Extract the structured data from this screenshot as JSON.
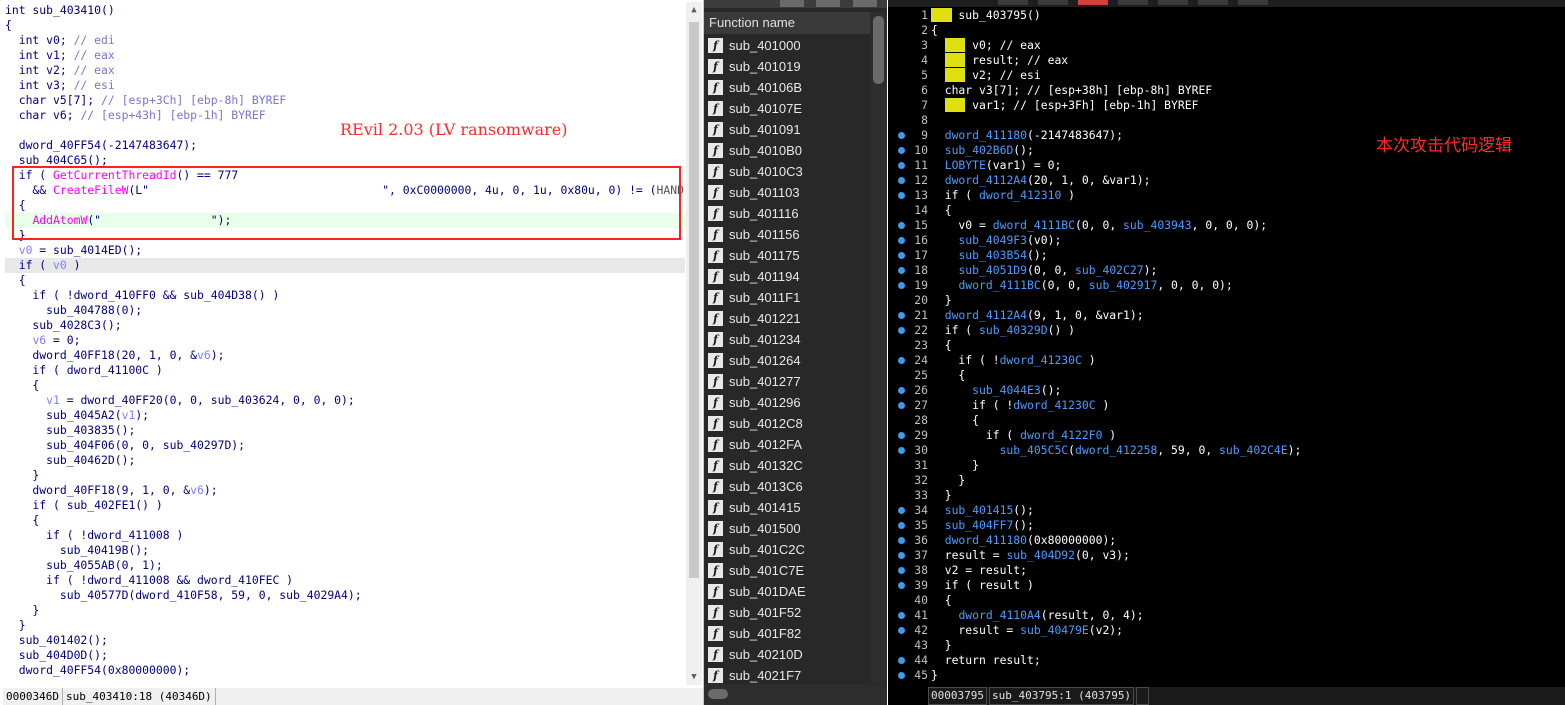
{
  "left": {
    "annotation": "REvil 2.03 (LV ransomware)",
    "status_address": "0000346D",
    "status_location": "sub_403410:18 (40346D)",
    "lines": [
      [
        [
          "int sub_403410()",
          "kw"
        ]
      ],
      [
        [
          "{",
          "kw"
        ]
      ],
      [
        [
          "  int v0; ",
          "kw"
        ],
        [
          "// edi",
          "cm"
        ]
      ],
      [
        [
          "  int v1; ",
          "kw"
        ],
        [
          "// eax",
          "cm"
        ]
      ],
      [
        [
          "  int v2; ",
          "kw"
        ],
        [
          "// eax",
          "cm"
        ]
      ],
      [
        [
          "  int v3; ",
          "kw"
        ],
        [
          "// esi",
          "cm"
        ]
      ],
      [
        [
          "  char v5[7]; ",
          "kw"
        ],
        [
          "// [esp+3Ch] [ebp-8h] BYREF",
          "cm"
        ]
      ],
      [
        [
          "  char v6; ",
          "kw"
        ],
        [
          "// [esp+43h] [ebp-1h] BYREF",
          "cm"
        ]
      ],
      [
        [
          "",
          ""
        ]
      ],
      [
        [
          "  dword_40FF54(-2147483647);",
          "kw"
        ]
      ],
      [
        [
          "  sub_404C65();",
          "kw"
        ]
      ],
      [
        [
          "  if ( ",
          "kw"
        ],
        [
          "GetCurrentThreadId",
          "fn"
        ],
        [
          "() == 777",
          "kw"
        ]
      ],
      [
        [
          "    && ",
          "kw"
        ],
        [
          "CreateFileW",
          "fn"
        ],
        [
          "(L\"                                  \", 0xC0000000, 4u, 0, 1u, 0x80u, 0) != (",
          "kw"
        ],
        [
          "HANDLE",
          "gr"
        ],
        [
          ")-",
          "kw"
        ]
      ],
      [
        [
          "  {",
          "kw"
        ]
      ],
      [
        [
          "    ",
          "kw"
        ],
        [
          "AddAtomW",
          "fn"
        ],
        [
          "(\"                \");",
          "kw"
        ]
      ],
      [
        [
          "  }",
          "kw"
        ]
      ],
      [
        [
          "  v0",
          "lvar"
        ],
        [
          " = sub_4014ED();",
          "kw"
        ]
      ],
      [
        [
          "  if ( ",
          "kw"
        ],
        [
          "v0",
          "lvar"
        ],
        [
          " )",
          "kw"
        ]
      ],
      [
        [
          "  {",
          "kw"
        ]
      ],
      [
        [
          "    if ( !dword_410FF0 && sub_404D38() )",
          "kw"
        ]
      ],
      [
        [
          "      sub_404788(0);",
          "kw"
        ]
      ],
      [
        [
          "    sub_4028C3();",
          "kw"
        ]
      ],
      [
        [
          "    ",
          "kw"
        ],
        [
          "v6",
          "lvar"
        ],
        [
          " = 0;",
          "kw"
        ]
      ],
      [
        [
          "    dword_40FF18(20, 1, 0, &",
          "kw"
        ],
        [
          "v6",
          "lvar"
        ],
        [
          ");",
          "kw"
        ]
      ],
      [
        [
          "    if ( dword_41100C )",
          "kw"
        ]
      ],
      [
        [
          "    {",
          "kw"
        ]
      ],
      [
        [
          "      ",
          "kw"
        ],
        [
          "v1",
          "lvar"
        ],
        [
          " = dword_40FF20(0, 0, sub_403624, 0, 0, 0);",
          "kw"
        ]
      ],
      [
        [
          "      sub_4045A2(",
          "kw"
        ],
        [
          "v1",
          "lvar"
        ],
        [
          ");",
          "kw"
        ]
      ],
      [
        [
          "      sub_403835();",
          "kw"
        ]
      ],
      [
        [
          "      sub_404F06(0, 0, sub_40297D);",
          "kw"
        ]
      ],
      [
        [
          "      sub_40462D();",
          "kw"
        ]
      ],
      [
        [
          "    }",
          "kw"
        ]
      ],
      [
        [
          "    dword_40FF18(9, 1, 0, &",
          "kw"
        ],
        [
          "v6",
          "lvar"
        ],
        [
          ");",
          "kw"
        ]
      ],
      [
        [
          "    if ( sub_402FE1() )",
          "kw"
        ]
      ],
      [
        [
          "    {",
          "kw"
        ]
      ],
      [
        [
          "      if ( !dword_411008 )",
          "kw"
        ]
      ],
      [
        [
          "        sub_40419B();",
          "kw"
        ]
      ],
      [
        [
          "      sub_4055AB(0, 1);",
          "kw"
        ]
      ],
      [
        [
          "      if ( !dword_411008 && dword_410FEC )",
          "kw"
        ]
      ],
      [
        [
          "        sub_40577D(dword_410F58, 59, 0, sub_4029A4);",
          "kw"
        ]
      ],
      [
        [
          "    }",
          "kw"
        ]
      ],
      [
        [
          "  }",
          "kw"
        ]
      ],
      [
        [
          "  sub_401402();",
          "kw"
        ]
      ],
      [
        [
          "  sub_404D0D();",
          "kw"
        ]
      ],
      [
        [
          "  dword_40FF54(0x80000000);",
          "kw"
        ]
      ]
    ]
  },
  "functions": {
    "header": "Function name",
    "items": [
      "sub_401000",
      "sub_401019",
      "sub_40106B",
      "sub_40107E",
      "sub_401091",
      "sub_4010B0",
      "sub_4010C3",
      "sub_401103",
      "sub_401116",
      "sub_401156",
      "sub_401175",
      "sub_401194",
      "sub_4011F1",
      "sub_401221",
      "sub_401234",
      "sub_401264",
      "sub_401277",
      "sub_401296",
      "sub_4012C8",
      "sub_4012FA",
      "sub_40132C",
      "sub_4013C6",
      "sub_401415",
      "sub_401500",
      "sub_401C2C",
      "sub_401C7E",
      "sub_401DAE",
      "sub_401F52",
      "sub_401F82",
      "sub_40210D",
      "sub_4021F7"
    ]
  },
  "right": {
    "annotation": "本次攻击代码逻辑",
    "status_address": "00003795",
    "status_location": "sub_403795:1 (403795)",
    "lines": [
      {
        "n": "1",
        "bp": false,
        "s": [
          [
            "int",
            "rkw"
          ],
          [
            " sub_403795()",
            "rk"
          ]
        ]
      },
      {
        "n": "2",
        "bp": false,
        "s": [
          [
            "{",
            "rk"
          ]
        ]
      },
      {
        "n": "3",
        "bp": false,
        "s": [
          [
            "  ",
            "rk"
          ],
          [
            "int",
            "rkw"
          ],
          [
            " v0; // eax",
            "rk"
          ]
        ]
      },
      {
        "n": "4",
        "bp": false,
        "s": [
          [
            "  ",
            "rk"
          ],
          [
            "int",
            "rkw"
          ],
          [
            " result; // eax",
            "rk"
          ]
        ]
      },
      {
        "n": "5",
        "bp": false,
        "s": [
          [
            "  ",
            "rk"
          ],
          [
            "int",
            "rkw"
          ],
          [
            " v2; // esi",
            "rk"
          ]
        ]
      },
      {
        "n": "6",
        "bp": false,
        "s": [
          [
            "  char v3[7]; // [esp+38h] [ebp-8h] BYREF",
            "rk"
          ]
        ]
      },
      {
        "n": "7",
        "bp": false,
        "s": [
          [
            "  ",
            "rk"
          ],
          [
            "int",
            "rkw"
          ],
          [
            " var1; // [esp+3Fh] [ebp-1h] BYREF",
            "rk"
          ]
        ]
      },
      {
        "n": "8",
        "bp": false,
        "s": [
          [
            "",
            "rk"
          ]
        ]
      },
      {
        "n": "9",
        "bp": true,
        "s": [
          [
            "  ",
            "rk"
          ],
          [
            "dword_411180",
            "rgv"
          ],
          [
            "(-2147483647);",
            "rk"
          ]
        ]
      },
      {
        "n": "10",
        "bp": true,
        "s": [
          [
            "  ",
            "rk"
          ],
          [
            "sub_402B6D",
            "rfn"
          ],
          [
            "();",
            "rk"
          ]
        ]
      },
      {
        "n": "11",
        "bp": true,
        "s": [
          [
            "  ",
            "rk"
          ],
          [
            "LOBYTE",
            "rgv"
          ],
          [
            "(var1) = 0;",
            "rk"
          ]
        ]
      },
      {
        "n": "12",
        "bp": true,
        "s": [
          [
            "  ",
            "rk"
          ],
          [
            "dword_4112A4",
            "rgv"
          ],
          [
            "(20, 1, 0, &var1);",
            "rk"
          ]
        ]
      },
      {
        "n": "13",
        "bp": true,
        "s": [
          [
            "  if ( ",
            "rk"
          ],
          [
            "dword_412310",
            "rgv"
          ],
          [
            " )",
            "rk"
          ]
        ]
      },
      {
        "n": "14",
        "bp": false,
        "s": [
          [
            "  {",
            "rk"
          ]
        ]
      },
      {
        "n": "15",
        "bp": true,
        "s": [
          [
            "    v0 = ",
            "rk"
          ],
          [
            "dword_4111BC",
            "rgv"
          ],
          [
            "(0, 0, ",
            "rk"
          ],
          [
            "sub_403943",
            "rfn"
          ],
          [
            ", 0, 0, 0);",
            "rk"
          ]
        ]
      },
      {
        "n": "16",
        "bp": true,
        "s": [
          [
            "    ",
            "rk"
          ],
          [
            "sub_4049F3",
            "rfn"
          ],
          [
            "(v0);",
            "rk"
          ]
        ]
      },
      {
        "n": "17",
        "bp": true,
        "s": [
          [
            "    ",
            "rk"
          ],
          [
            "sub_403B54",
            "rfn"
          ],
          [
            "();",
            "rk"
          ]
        ]
      },
      {
        "n": "18",
        "bp": true,
        "s": [
          [
            "    ",
            "rk"
          ],
          [
            "sub_4051D9",
            "rfn"
          ],
          [
            "(0, 0, ",
            "rk"
          ],
          [
            "sub_402C27",
            "rfn"
          ],
          [
            ");",
            "rk"
          ]
        ]
      },
      {
        "n": "19",
        "bp": true,
        "s": [
          [
            "    ",
            "rk"
          ],
          [
            "dword_4111BC",
            "rgv"
          ],
          [
            "(0, 0, ",
            "rk"
          ],
          [
            "sub_402917",
            "rfn"
          ],
          [
            ", 0, 0, 0);",
            "rk"
          ]
        ]
      },
      {
        "n": "20",
        "bp": false,
        "s": [
          [
            "  }",
            "rk"
          ]
        ]
      },
      {
        "n": "21",
        "bp": true,
        "s": [
          [
            "  ",
            "rk"
          ],
          [
            "dword_4112A4",
            "rgv"
          ],
          [
            "(9, 1, 0, &var1);",
            "rk"
          ]
        ]
      },
      {
        "n": "22",
        "bp": true,
        "s": [
          [
            "  if ( ",
            "rk"
          ],
          [
            "sub_40329D",
            "rfn"
          ],
          [
            "() )",
            "rk"
          ]
        ]
      },
      {
        "n": "23",
        "bp": false,
        "s": [
          [
            "  {",
            "rk"
          ]
        ]
      },
      {
        "n": "24",
        "bp": true,
        "s": [
          [
            "    if ( !",
            "rk"
          ],
          [
            "dword_41230C",
            "rgv"
          ],
          [
            " )",
            "rk"
          ]
        ]
      },
      {
        "n": "25",
        "bp": false,
        "s": [
          [
            "    {",
            "rk"
          ]
        ]
      },
      {
        "n": "26",
        "bp": true,
        "s": [
          [
            "      ",
            "rk"
          ],
          [
            "sub_4044E3",
            "rfn"
          ],
          [
            "();",
            "rk"
          ]
        ]
      },
      {
        "n": "27",
        "bp": true,
        "s": [
          [
            "      if ( !",
            "rk"
          ],
          [
            "dword_41230C",
            "rgv"
          ],
          [
            " )",
            "rk"
          ]
        ]
      },
      {
        "n": "28",
        "bp": false,
        "s": [
          [
            "      {",
            "rk"
          ]
        ]
      },
      {
        "n": "29",
        "bp": true,
        "s": [
          [
            "        if ( ",
            "rk"
          ],
          [
            "dword_4122F0",
            "rgv"
          ],
          [
            " )",
            "rk"
          ]
        ]
      },
      {
        "n": "30",
        "bp": true,
        "s": [
          [
            "          ",
            "rk"
          ],
          [
            "sub_405C5C",
            "rfn"
          ],
          [
            "(",
            "rk"
          ],
          [
            "dword_412258",
            "rgv"
          ],
          [
            ", 59, 0, ",
            "rk"
          ],
          [
            "sub_402C4E",
            "rfn"
          ],
          [
            ");",
            "rk"
          ]
        ]
      },
      {
        "n": "31",
        "bp": false,
        "s": [
          [
            "      }",
            "rk"
          ]
        ]
      },
      {
        "n": "32",
        "bp": false,
        "s": [
          [
            "    }",
            "rk"
          ]
        ]
      },
      {
        "n": "33",
        "bp": false,
        "s": [
          [
            "  }",
            "rk"
          ]
        ]
      },
      {
        "n": "34",
        "bp": true,
        "s": [
          [
            "  ",
            "rk"
          ],
          [
            "sub_401415",
            "rfn"
          ],
          [
            "();",
            "rk"
          ]
        ]
      },
      {
        "n": "35",
        "bp": true,
        "s": [
          [
            "  ",
            "rk"
          ],
          [
            "sub_404FF7",
            "rfn"
          ],
          [
            "();",
            "rk"
          ]
        ]
      },
      {
        "n": "36",
        "bp": true,
        "s": [
          [
            "  ",
            "rk"
          ],
          [
            "dword_411180",
            "rgv"
          ],
          [
            "(0x80000000);",
            "rk"
          ]
        ]
      },
      {
        "n": "37",
        "bp": true,
        "s": [
          [
            "  result = ",
            "rk"
          ],
          [
            "sub_404D92",
            "rfn"
          ],
          [
            "(0, v3);",
            "rk"
          ]
        ]
      },
      {
        "n": "38",
        "bp": true,
        "s": [
          [
            "  v2 = result;",
            "rk"
          ]
        ]
      },
      {
        "n": "39",
        "bp": true,
        "s": [
          [
            "  if ( result )",
            "rk"
          ]
        ]
      },
      {
        "n": "40",
        "bp": false,
        "s": [
          [
            "  {",
            "rk"
          ]
        ]
      },
      {
        "n": "41",
        "bp": true,
        "s": [
          [
            "    ",
            "rk"
          ],
          [
            "dword_4110A4",
            "rgv"
          ],
          [
            "(result, 0, 4);",
            "rk"
          ]
        ]
      },
      {
        "n": "42",
        "bp": true,
        "s": [
          [
            "    result = ",
            "rk"
          ],
          [
            "sub_40479E",
            "rfn"
          ],
          [
            "(v2);",
            "rk"
          ]
        ]
      },
      {
        "n": "43",
        "bp": false,
        "s": [
          [
            "  }",
            "rk"
          ]
        ]
      },
      {
        "n": "44",
        "bp": true,
        "s": [
          [
            "  return result;",
            "rk"
          ]
        ]
      },
      {
        "n": "45",
        "bp": true,
        "s": [
          [
            "}",
            "rk"
          ]
        ]
      }
    ]
  },
  "colors": {
    "highlight_box": "#ff2020",
    "annotation_text": "#ff2a2a",
    "keyword_highlight": "#e0e010",
    "dark_identifier": "#4a9cff",
    "breakpoint_dot": "#3d9be9"
  }
}
